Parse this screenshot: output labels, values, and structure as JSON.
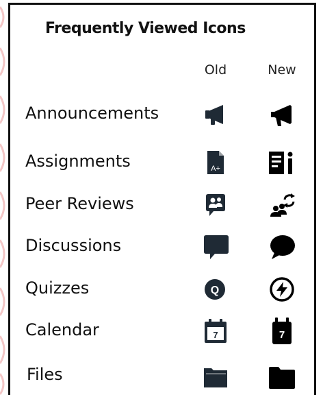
{
  "title": "Frequently Viewed Icons",
  "columns": {
    "old": "Old",
    "new": "New"
  },
  "rows": [
    {
      "label": "Announcements",
      "old_icon": "megaphone-old-icon",
      "new_icon": "megaphone-new-icon"
    },
    {
      "label": "Assignments",
      "old_icon": "assignment-document-old-icon",
      "new_icon": "assignment-document-new-icon"
    },
    {
      "label": "Peer Reviews",
      "old_icon": "peer-review-old-icon",
      "new_icon": "peer-review-new-icon"
    },
    {
      "label": "Discussions",
      "old_icon": "speech-bubble-old-icon",
      "new_icon": "speech-bubble-new-icon"
    },
    {
      "label": "Quizzes",
      "old_icon": "quiz-q-old-icon",
      "new_icon": "quiz-bolt-new-icon"
    },
    {
      "label": "Calendar",
      "old_icon": "calendar-old-icon",
      "new_icon": "calendar-new-icon"
    },
    {
      "label": "Files",
      "old_icon": "folder-old-icon",
      "new_icon": "folder-new-icon"
    }
  ],
  "icon_text": {
    "assignment_badge": "A+",
    "quiz_letter": "Q",
    "calendar_day": "7"
  },
  "colors": {
    "old_icon": "#1f2a35",
    "new_icon": "#000000",
    "edge_accent": "#f3c6c6"
  }
}
